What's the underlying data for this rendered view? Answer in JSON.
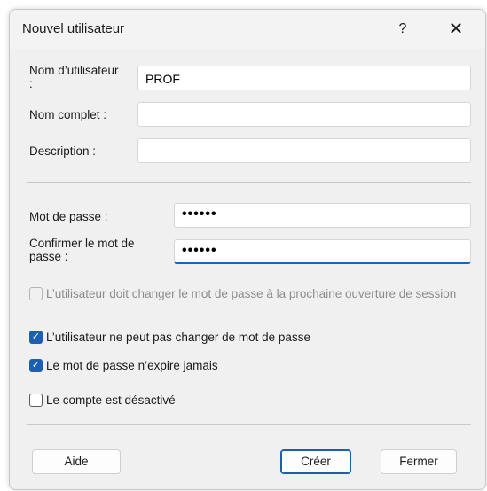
{
  "window": {
    "title": "Nouvel utilisateur",
    "help_label": "?",
    "close_label": "✕"
  },
  "form": {
    "username_label": "Nom d’utilisateur :",
    "username_value": "PROF",
    "fullname_label": "Nom complet :",
    "fullname_value": "",
    "description_label": "Description :",
    "description_value": "",
    "password_label": "Mot de passe :",
    "password_value": "••••••",
    "confirm_label": "Confirmer le mot de passe :",
    "confirm_value": "••••••"
  },
  "options": {
    "must_change": {
      "label": "L’utilisateur doit changer le mot de passe à la prochaine ouverture de session",
      "checked": false,
      "disabled": true
    },
    "cannot_change": {
      "label": "L’utilisateur ne peut pas changer de mot de passe",
      "checked": true
    },
    "never_expires": {
      "label": "Le mot de passe n’expire jamais",
      "checked": true
    },
    "disabled_account": {
      "label": "Le compte est désactivé",
      "checked": false
    }
  },
  "buttons": {
    "help": "Aide",
    "create": "Créer",
    "close": "Fermer"
  },
  "colors": {
    "accent": "#1a5fb4",
    "dialog_bg": "#f0f0f0"
  }
}
